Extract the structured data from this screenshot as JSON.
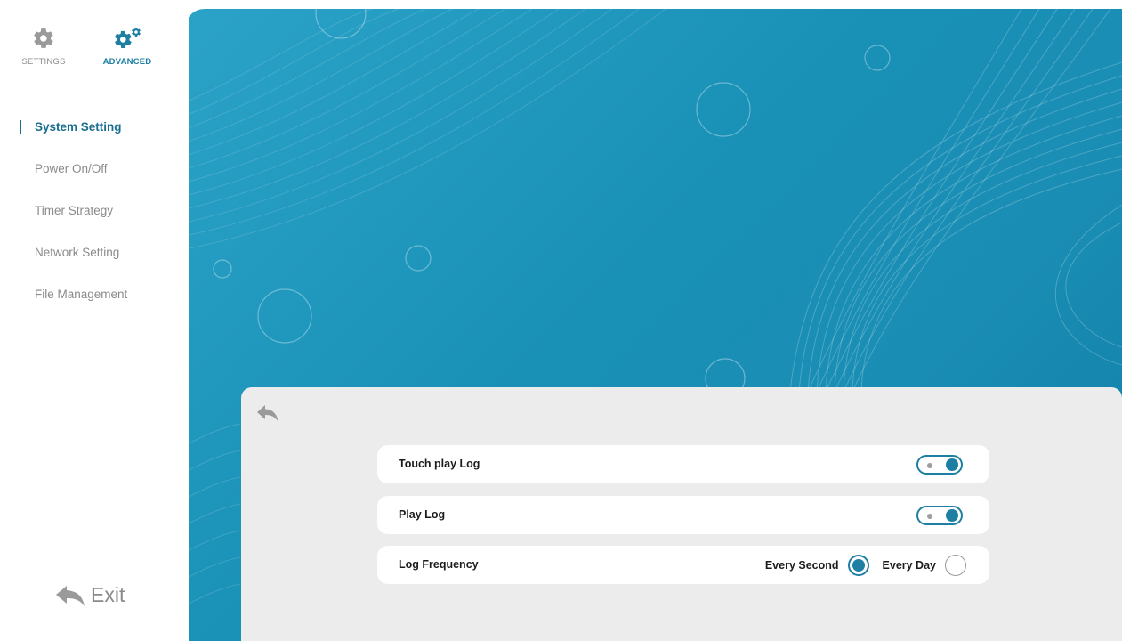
{
  "top_tabs": {
    "settings_label": "SETTINGS",
    "advanced_label": "ADVANCED"
  },
  "menu": {
    "items": [
      {
        "label": "System Setting",
        "active": true
      },
      {
        "label": "Power On/Off",
        "active": false
      },
      {
        "label": "Timer Strategy",
        "active": false
      },
      {
        "label": "Network Setting",
        "active": false
      },
      {
        "label": "File Management",
        "active": false
      }
    ]
  },
  "exit_label": "Exit",
  "panel": {
    "rows": [
      {
        "label": "Touch play Log",
        "toggle_on": true
      },
      {
        "label": "Play Log",
        "toggle_on": true
      },
      {
        "label": "Log Frequency"
      }
    ],
    "log_frequency": {
      "options": [
        "Every Second",
        "Every Day"
      ],
      "selected": "Every Second"
    }
  },
  "colors": {
    "accent": "#1e7fa3",
    "muted_text": "#8a8a8a",
    "panel_bg": "#ececec",
    "background_blue": "#1990b6"
  },
  "icons": {
    "settings": "gear-icon",
    "advanced": "gears-icon",
    "back": "back-arrow-icon",
    "exit": "exit-arrow-icon"
  }
}
